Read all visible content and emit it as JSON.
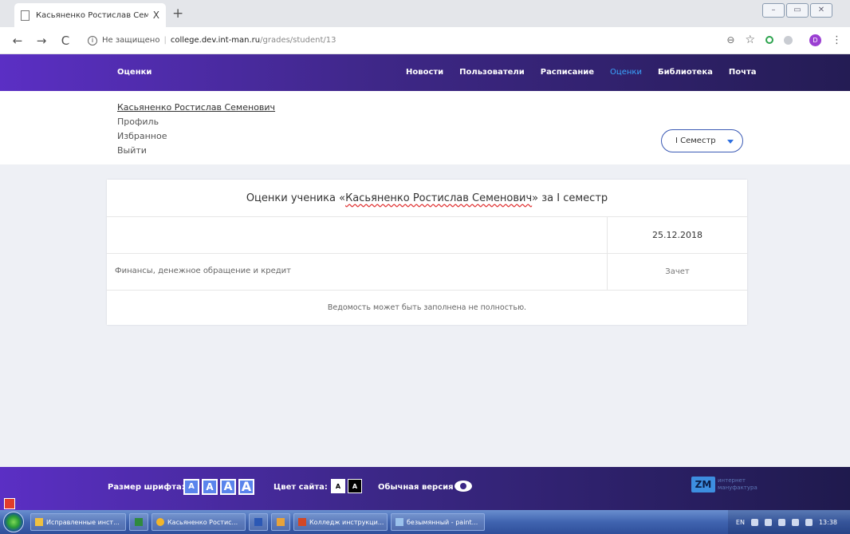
{
  "browser": {
    "tab_title": "Касьяненко Ростислав Семенович",
    "tab_close": "X",
    "new_tab": "+",
    "security_label": "Не защищено",
    "url_host": "college.dev.int-man.ru",
    "url_path": "/grades/student/13",
    "profile_initial": "D"
  },
  "header": {
    "brand": "Оценки",
    "nav": [
      "Новости",
      "Пользователи",
      "Расписание",
      "Оценки",
      "Библиотека",
      "Почта"
    ],
    "active_index": 3
  },
  "user_menu": {
    "name": "Касьяненко Ростислав Семенович",
    "profile": "Профиль",
    "favorites": "Избранное",
    "logout": "Выйти"
  },
  "semester_select": {
    "value": "I Семестр"
  },
  "grades": {
    "title_prefix": "Оценки ученика «",
    "student": "Касьяненко Ростислав Семенович",
    "title_suffix": "» за I семестр",
    "date": "25.12.2018",
    "subject": "Финансы, денежное обращение и кредит",
    "grade": "Зачет",
    "note": "Ведомость может быть заполнена не полностью."
  },
  "footer": {
    "font_size_label": "Размер шрифта:",
    "font_sizes": [
      "A",
      "A",
      "A",
      "A"
    ],
    "color_label": "Цвет сайта:",
    "colors": [
      "A",
      "A"
    ],
    "normal_version": "Обычная версия",
    "logo_mark": "ZM",
    "logo_line1": "интернет",
    "logo_line2": "мануфактура"
  },
  "taskbar": {
    "items": [
      "Исправленные инст...",
      "Касьяненко Ростис...",
      "Колледж инструкци...",
      "безымянный - paint..."
    ],
    "lang": "EN",
    "clock": "13:38"
  },
  "colors": {
    "header_start": "#5b2fc4",
    "header_end": "#241c54",
    "active_nav": "#3aa7ff",
    "accent_blue": "#3c5bb5",
    "page_bg": "#eef0f5"
  }
}
